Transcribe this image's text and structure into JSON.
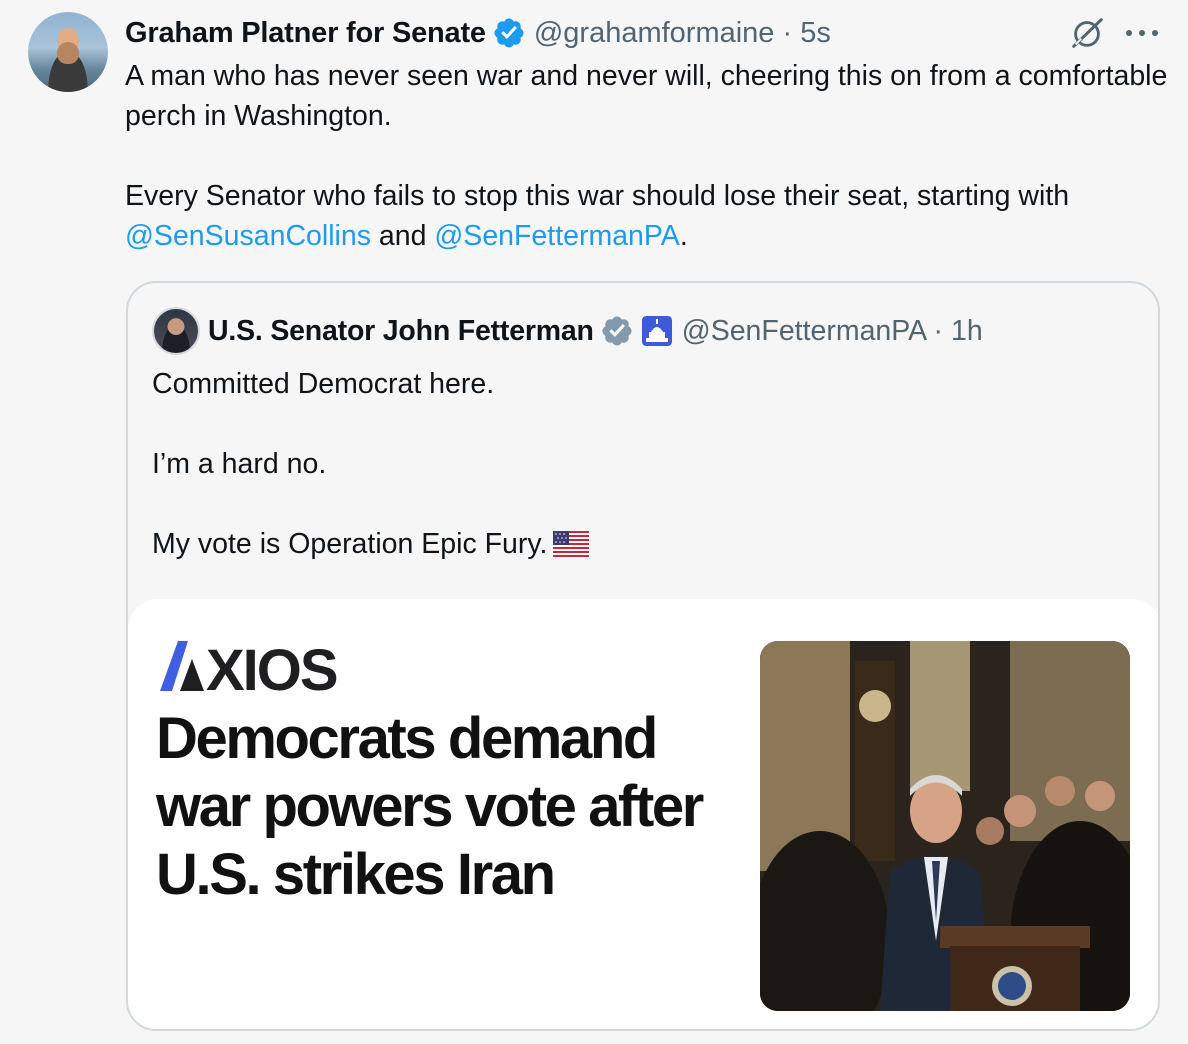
{
  "tweet": {
    "display_name": "Graham Platner for Senate",
    "handle": "@grahamformaine",
    "time": "5s",
    "body": {
      "line1": "A man who has never seen war and never will, cheering this on from a comfortable perch in Washington.",
      "line2_prefix": "Every Senator who fails to stop this war should lose their seat, starting with ",
      "mention1": "@SenSusanCollins",
      "connector": " and ",
      "mention2": "@SenFettermanPA",
      "suffix": "."
    }
  },
  "quoted": {
    "display_name": "U.S. Senator John Fetterman",
    "handle": "@SenFettermanPA",
    "time": "1h",
    "lines": [
      "Committed Democrat here.",
      "I’m a hard no.",
      "My vote is Operation Epic Fury."
    ],
    "card": {
      "publisher": "AXIOS",
      "headline": "Democrats demand war powers vote after U.S. strikes Iran"
    }
  },
  "icons": {
    "verified": "verified-badge-icon",
    "grok": "grok-icon",
    "more": "more-icon",
    "capitol": "capitol-icon",
    "flag": "us-flag-icon"
  },
  "colors": {
    "link": "#1d9bf0",
    "muted": "#536471",
    "verified_blue": "#1d9bf0",
    "verified_gray": "#829aab"
  }
}
